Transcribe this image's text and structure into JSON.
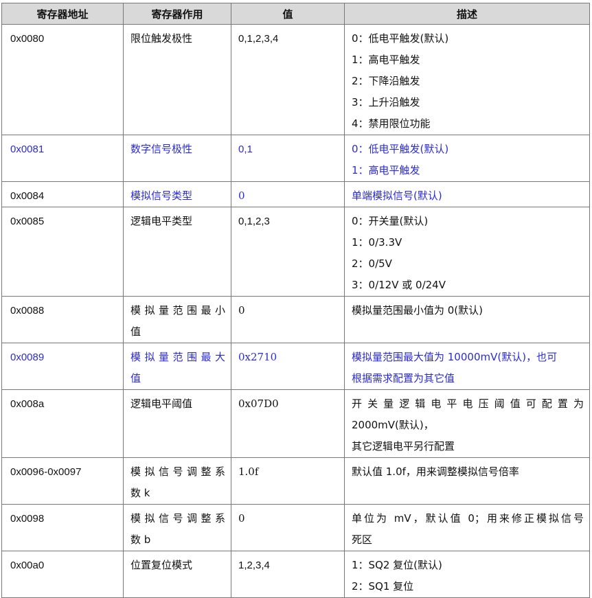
{
  "headers": [
    "寄存器地址",
    "寄存器作用",
    "值",
    "描述"
  ],
  "rows": [
    {
      "addr": "0x0080",
      "func": "限位触发极性",
      "value": "0,1,2,3,4",
      "desc": [
        "0：低电平触发(默认)",
        "1：高电平触发",
        "2：下降沿触发",
        "3：上升沿触发",
        "4：禁用限位功能"
      ]
    },
    {
      "addr": "0x0081",
      "func": "数字信号极性",
      "value": "0,1",
      "desc": [
        "0：低电平触发(默认)",
        "1：高电平触发"
      ]
    },
    {
      "addr": "0x0084",
      "func": "模拟信号类型",
      "value": "0",
      "desc": [
        "单端模拟信号(默认)"
      ]
    },
    {
      "addr": "0x0085",
      "func": "逻辑电平类型",
      "value": "0,1,2,3",
      "desc": [
        "0：开关量(默认)",
        "1：0/3.3V",
        "2：0/5V",
        "3：0/12V 或 0/24V"
      ]
    },
    {
      "addr": "0x0088",
      "func": [
        "模拟量范围最小",
        "值"
      ],
      "value": "0",
      "desc": [
        "模拟量范围最小值为 0(默认)"
      ]
    },
    {
      "addr": "0x0089",
      "func": [
        "模拟量范围最大",
        "值"
      ],
      "value": "0x2710",
      "desc": [
        "模拟量范围最大值为 10000mV(默认)，也可",
        "根据需求配置为其它值"
      ]
    },
    {
      "addr": "0x008a",
      "func": "逻辑电平阈值",
      "value": "0x07D0",
      "desc": [
        "开关量逻辑电平电压阈值可配置为",
        "2000mV(默认)，",
        "其它逻辑电平另行配置"
      ]
    },
    {
      "addr": "0x0096-0x0097",
      "func": [
        "模拟信号调整系",
        "数 k"
      ],
      "value": "1.0f",
      "desc": [
        "默认值 1.0f，用来调整模拟信号倍率"
      ]
    },
    {
      "addr": "0x0098",
      "func": [
        "模拟信号调整系",
        "数 b"
      ],
      "value": "0",
      "desc": [
        "单位为 mV，默认值 0；用来修正模拟信号",
        "死区"
      ]
    },
    {
      "addr": "0x00a0",
      "func": "位置复位模式",
      "value": "1,2,3,4",
      "desc": [
        "1：SQ2 复位(默认)",
        "2：SQ1 复位"
      ]
    }
  ],
  "colors": {
    "header_bg": "#d9d9d9",
    "highlight_text": "#2b2bd6",
    "border": "#777777"
  }
}
